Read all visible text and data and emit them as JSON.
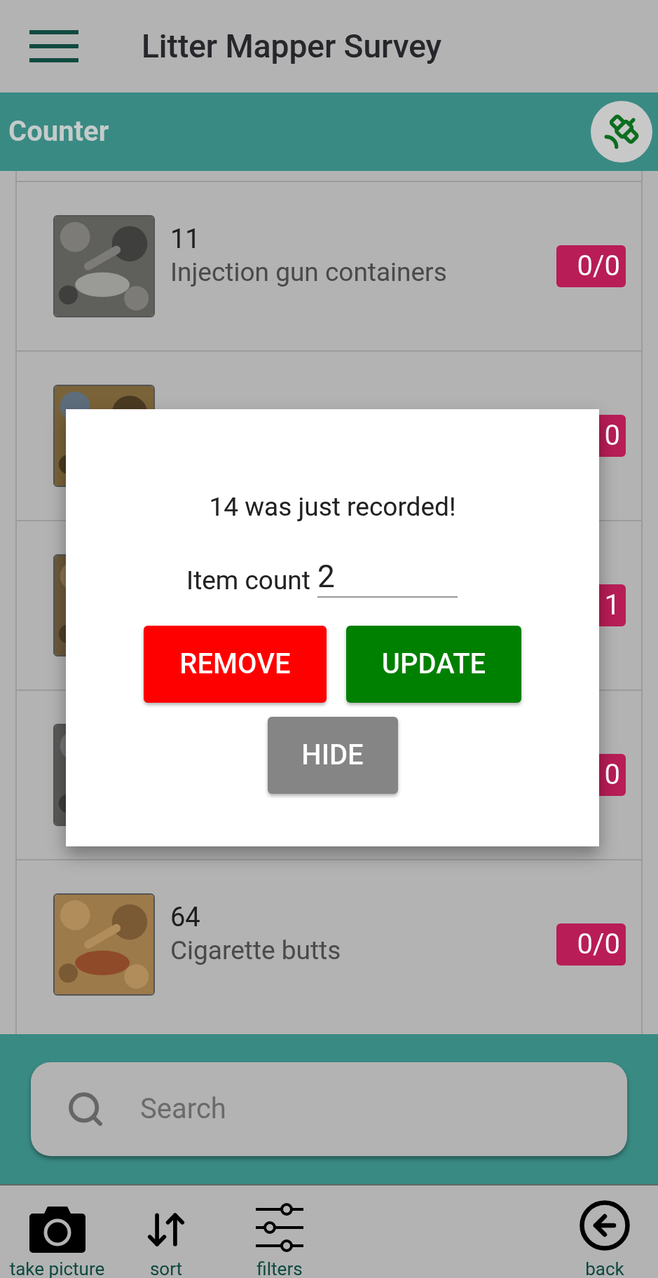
{
  "app_bar": {
    "title": "Litter Mapper Survey"
  },
  "section_bar": {
    "title": "Counter"
  },
  "items": [
    {
      "number": "11",
      "name": "Injection gun containers",
      "badge": "0/0"
    },
    {
      "badge": "0"
    },
    {
      "badge": "1"
    },
    {
      "badge": "0"
    },
    {
      "number": "64",
      "name": "Cigarette butts",
      "badge": "0/0"
    }
  ],
  "dialog": {
    "message": "14 was just recorded!",
    "field_label": "Item count",
    "field_value": "2",
    "buttons": [
      {
        "label": "REMOVE",
        "kind": "remove"
      },
      {
        "label": "UPDATE",
        "kind": "update"
      },
      {
        "label": "HIDE",
        "kind": "hide"
      }
    ]
  },
  "search": {
    "placeholder": "Search"
  },
  "toolbar": [
    {
      "label": "take picture",
      "kind": "camera"
    },
    {
      "label": "sort",
      "kind": "sort"
    },
    {
      "label": "filters",
      "kind": "filters"
    },
    {
      "label": "back",
      "kind": "back"
    }
  ]
}
